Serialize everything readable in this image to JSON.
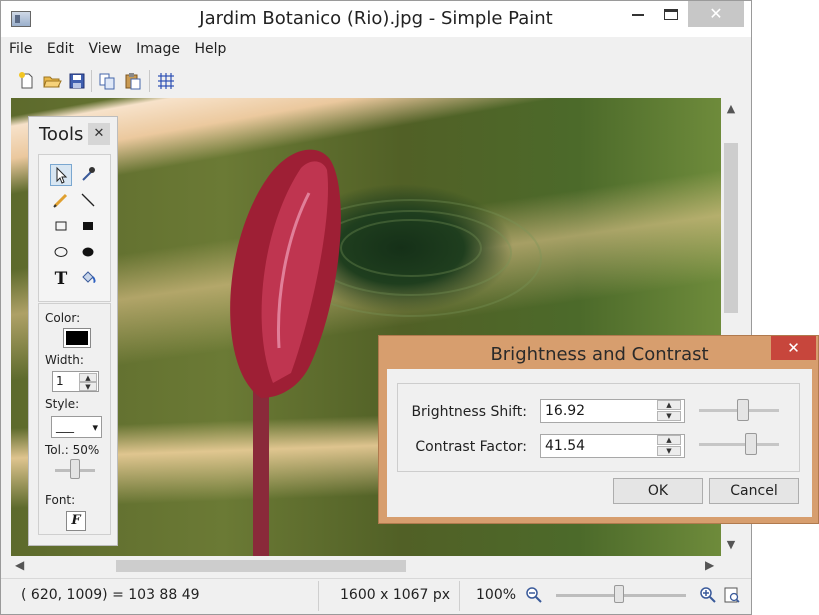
{
  "window": {
    "title": "Jardim Botanico (Rio).jpg - Simple Paint",
    "close_glyph": "✕"
  },
  "menu": [
    "File",
    "Edit",
    "View",
    "Image",
    "Help"
  ],
  "toolbar_icons": [
    "new-file-icon",
    "open-folder-icon",
    "save-icon",
    "copy-icon",
    "paste-icon",
    "grid-icon"
  ],
  "tools_panel": {
    "title": "Tools",
    "close_glyph": "✕",
    "tools": [
      "select-arrow",
      "eyedropper",
      "pencil",
      "line",
      "rectangle-outline",
      "rectangle-filled",
      "ellipse-outline",
      "ellipse-filled",
      "text",
      "fill-bucket"
    ],
    "selected_tool": "select-arrow",
    "color_label": "Color:",
    "color_value": "#000000",
    "width_label": "Width:",
    "width_value": "1",
    "style_label": "Style:",
    "style_value": "___",
    "tolerance_label": "Tol.: 50%",
    "tolerance": 0.5,
    "font_label": "Font:",
    "font_glyph": "F"
  },
  "status": {
    "pixel_info": "( 620, 1009) = 103  88  49",
    "image_size": "1600 x 1067 px",
    "zoom": "100%",
    "zoom_level": 0.5
  },
  "dialog": {
    "title": "Brightness and Contrast",
    "close_glyph": "✕",
    "brightness_label": "Brightness Shift:",
    "brightness_value": "16.92",
    "contrast_label": "Contrast Factor:",
    "contrast_value": "41.54",
    "ok_label": "OK",
    "cancel_label": "Cancel"
  },
  "colors": {
    "dialog_frame": "#d79e6e",
    "dialog_close": "#c7463c"
  }
}
